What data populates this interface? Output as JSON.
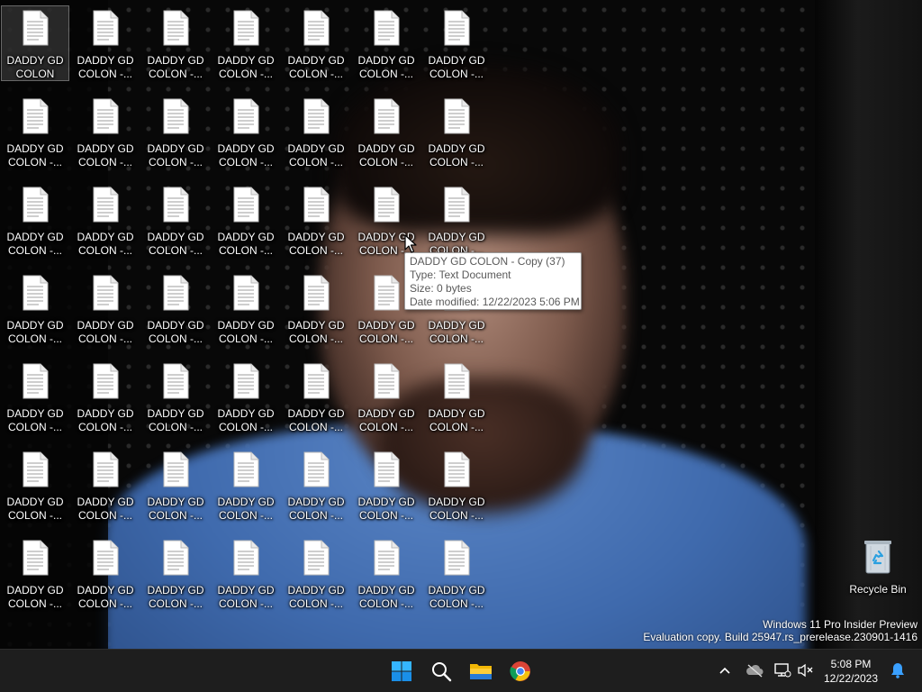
{
  "desktop": {
    "icon_grid": [
      [
        "DADDY GD\nCOLON",
        "DADDY GD\nCOLON -...",
        "DADDY GD\nCOLON -...",
        "DADDY GD\nCOLON -...",
        "DADDY GD\nCOLON -...",
        "DADDY GD\nCOLON -...",
        "DADDY GD\nCOLON -..."
      ],
      [
        "DADDY GD\nCOLON -...",
        "DADDY GD\nCOLON -...",
        "DADDY GD\nCOLON -...",
        "DADDY GD\nCOLON -...",
        "DADDY GD\nCOLON -...",
        "DADDY GD\nCOLON -...",
        "DADDY GD\nCOLON -..."
      ],
      [
        "DADDY GD\nCOLON -...",
        "DADDY GD\nCOLON -...",
        "DADDY GD\nCOLON -...",
        "DADDY GD\nCOLON -...",
        "DADDY GD\nCOLON -...",
        "DADDY GD\nCOLON -...",
        "DADDY GD\nCOLON -..."
      ],
      [
        "DADDY GD\nCOLON -...",
        "DADDY GD\nCOLON -...",
        "DADDY GD\nCOLON -...",
        "DADDY GD\nCOLON -...",
        "DADDY GD\nCOLON -...",
        "DADDY GD\nCOLON -...",
        "DADDY GD\nCOLON -..."
      ],
      [
        "DADDY GD\nCOLON -...",
        "DADDY GD\nCOLON -...",
        "DADDY GD\nCOLON -...",
        "DADDY GD\nCOLON -...",
        "DADDY GD\nCOLON -...",
        "DADDY GD\nCOLON -...",
        "DADDY GD\nCOLON -..."
      ],
      [
        "DADDY GD\nCOLON -...",
        "DADDY GD\nCOLON -...",
        "DADDY GD\nCOLON -...",
        "DADDY GD\nCOLON -...",
        "DADDY GD\nCOLON -...",
        "DADDY GD\nCOLON -...",
        "DADDY GD\nCOLON -..."
      ],
      [
        "DADDY GD\nCOLON -...",
        "DADDY GD\nCOLON -...",
        "DADDY GD\nCOLON -...",
        "DADDY GD\nCOLON -...",
        "DADDY GD\nCOLON -...",
        "DADDY GD\nCOLON -...",
        "DADDY GD\nCOLON -..."
      ]
    ],
    "icon_type": "text-document-icon",
    "selected_icon": "DADDY GD\nCOLON",
    "recycle_bin": {
      "label": "Recycle Bin",
      "icon": "recycle-bin-icon"
    }
  },
  "tooltip": {
    "title": "DADDY GD COLON - Copy (37)",
    "type": "Type: Text Document",
    "size": "Size: 0 bytes",
    "modified": "Date modified: 12/22/2023 5:06 PM"
  },
  "watermark": {
    "line1": "Windows 11 Pro Insider Preview",
    "line2": "Evaluation copy. Build 25947.rs_prerelease.230901-1416"
  },
  "taskbar": {
    "pinned": [
      "start-icon",
      "search-icon",
      "file-explorer-icon",
      "chrome-icon"
    ],
    "tray": [
      "chevron-up-icon",
      "onedrive-offline-icon",
      "network-icon",
      "volume-muted-icon"
    ],
    "clock": {
      "time": "5:08 PM",
      "date": "12/22/2023"
    },
    "notification_icon": "bell-icon"
  },
  "colors": {
    "taskbar_bg": "#1e1e1e",
    "windows_blue": "#1a9bf0",
    "folder_yellow": "#f4b400",
    "shirt_blue": "#4a76ba"
  }
}
